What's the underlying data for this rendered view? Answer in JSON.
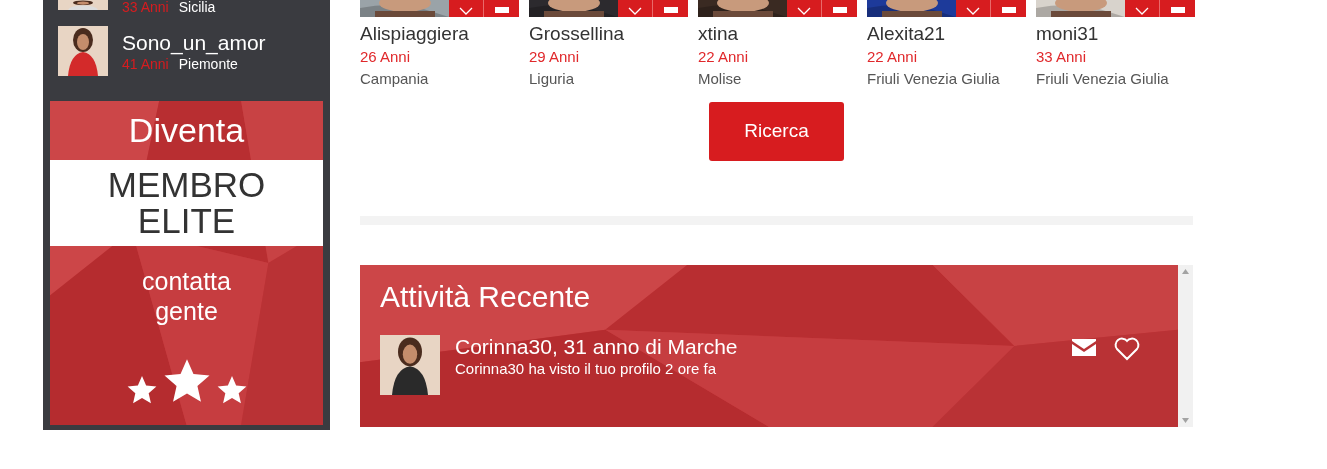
{
  "sidebar": {
    "members": [
      {
        "age": "33 Anni",
        "region": "Sicilia"
      },
      {
        "name": "Sono_un_amor",
        "age": "41 Anni",
        "region": "Piemonte"
      }
    ],
    "elite_promo": {
      "heading": "Diventa",
      "title_lines": [
        "MEMBRO",
        "ELITE"
      ],
      "caption_lines": [
        "contatta",
        "gente"
      ]
    }
  },
  "profiles": [
    {
      "name": "Alispiaggiera",
      "age": "26 Anni",
      "region": "Campania"
    },
    {
      "name": "Grossellina",
      "age": "29 Anni",
      "region": "Liguria"
    },
    {
      "name": "xtina",
      "age": "22 Anni",
      "region": "Molise"
    },
    {
      "name": "Alexita21",
      "age": "22 Anni",
      "region": "Friuli Venezia Giulia"
    },
    {
      "name": "moni31",
      "age": "33 Anni",
      "region": "Friuli Venezia Giulia"
    }
  ],
  "search_button": "Ricerca",
  "recent_activity": {
    "title": "Attività Recente",
    "items": [
      {
        "headline": "Corinna30, 31 anno di Marche",
        "detail": "Corinna30 ha visto il tuo profilo 2 ore fa"
      }
    ]
  }
}
